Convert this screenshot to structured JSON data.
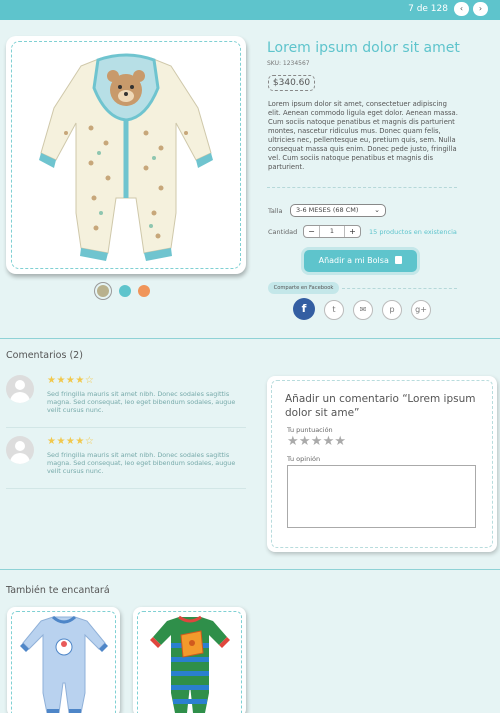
{
  "pager": {
    "counter": "7 de 128",
    "prev_icon": "‹",
    "next_icon": "›"
  },
  "product": {
    "title": "Lorem ipsum dolor sit amet",
    "sku": "SKU: 1234567",
    "price": "$340.60",
    "description": "Lorem ipsum dolor sit amet, consectetuer adipiscing elit. Aenean commodo ligula eget dolor. Aenean massa. Cum sociis natoque penatibus et magnis dis parturient montes, nascetur ridiculus mus. Donec quam felis, ultricies nec, pellentesque eu, pretium quis, sem. Nulla consequat massa quis enim. Donec pede justo, fringilla vel. Cum sociis natoque penatibus et magnis dis parturient.",
    "size_label": "Talla",
    "size_value": "3-6 MESES (68 CM)",
    "qty_label": "Cantidad",
    "qty_value": "1",
    "stock": "15 productos en existencia",
    "add_button": "Añadir a mi Bolsa",
    "share_label": "Comparte en Facebook",
    "color_swatches": [
      "#b9b18d",
      "#5ec4cc",
      "#f0955a"
    ],
    "social_icons": [
      "facebook-icon",
      "twitter-icon",
      "email-icon",
      "pinterest-icon",
      "google-plus-icon"
    ]
  },
  "comments": {
    "heading": "Comentarios (2)",
    "items": [
      {
        "stars": "★★★★☆",
        "rating": 4,
        "text": "Sed fringilla mauris sit amet nibh. Donec sodales sagittis magna. Sed consequat, leo eget bibendum sodales, augue velit cursus nunc."
      },
      {
        "stars": "★★★★☆",
        "rating": 4,
        "text": "Sed fringilla mauris sit amet nibh. Donec sodales sagittis magna. Sed consequat, leo eget bibendum sodales, augue velit cursus nunc."
      }
    ]
  },
  "review_form": {
    "title": "Añadir un comentario “Lorem ipsum dolor sit ame”",
    "rating_label": "Tu puntuación",
    "rating_stars": "★★★★★",
    "opinion_label": "Tu opinión"
  },
  "related": {
    "heading": "También te encantará"
  },
  "colors": {
    "accent": "#5ec4cc",
    "background": "#e6f4f4",
    "facebook": "#345ea2",
    "star": "#f1c84c"
  }
}
